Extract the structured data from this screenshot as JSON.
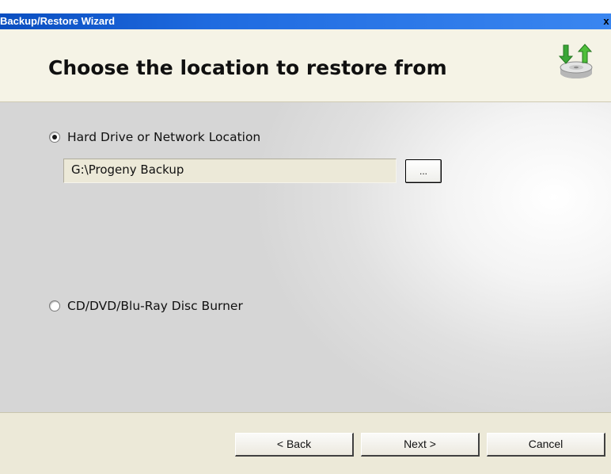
{
  "window": {
    "title": "Backup/Restore Wizard",
    "close_label": "x"
  },
  "header": {
    "title": "Choose the location to restore from",
    "icon": "backup-restore-drive-icon"
  },
  "options": {
    "hard_drive_label": "Hard Drive or Network Location",
    "hard_drive_selected": true,
    "path_value": "G:\\Progeny Backup",
    "browse_label": "...",
    "disc_label": "CD/DVD/Blu-Ray Disc Burner",
    "disc_selected": false
  },
  "footer": {
    "back_label": "< Back",
    "next_label": "Next >",
    "cancel_label": "Cancel"
  },
  "colors": {
    "titlebar": "#0a4ec0",
    "header_bg": "#f5f3e6",
    "footer_bg": "#ece9d8",
    "icon_green": "#3aa637"
  }
}
